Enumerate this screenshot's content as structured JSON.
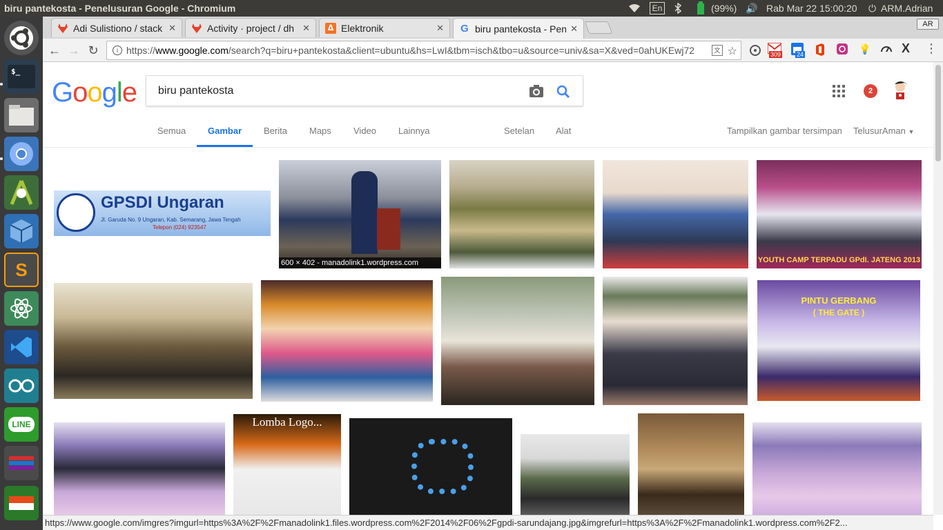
{
  "window_title": "biru pantekosta - Penelusuran Google - Chromium",
  "indicators": {
    "lang": "En",
    "battery": "(99%)",
    "volume": "🔊",
    "datetime": "Rab Mar 22 15:00:20",
    "user": "ARM.Adrian"
  },
  "tabs": [
    {
      "title": "Adi Sulistiono / stack",
      "favicon": "gitlab-icon",
      "color": "#e24329"
    },
    {
      "title": "Activity · project / dh",
      "favicon": "gitlab-icon",
      "color": "#e24329"
    },
    {
      "title": "Elektronik",
      "favicon": "shop-icon",
      "color": "#f57224"
    },
    {
      "title": "biru pantekosta - Pen",
      "favicon": "google-icon",
      "color": "#4285f4"
    }
  ],
  "profile_badge": "AR",
  "url": {
    "scheme": "https://",
    "domain": "www.google.com",
    "path": "/search?q=biru+pantekosta&client=ubuntu&hs=LwI&tbm=isch&tbo=u&source=univ&sa=X&ved=0ahUKEwj72"
  },
  "extensions": [
    {
      "name": "gmail-icon",
      "badge": "309",
      "color": "#d93025"
    },
    {
      "name": "calendar-icon",
      "badge": "24",
      "color": "#1a73e8"
    },
    {
      "name": "office-icon",
      "badge": "",
      "color": "#eb3c00"
    },
    {
      "name": "instagram-icon",
      "badge": "",
      "color": "#c13584"
    }
  ],
  "search": {
    "query": "biru pantekosta",
    "notifications": "2"
  },
  "nav_tabs": [
    "Semua",
    "Gambar",
    "Berita",
    "Maps",
    "Video",
    "Lainnya"
  ],
  "nav_tools": [
    "Setelan",
    "Alat"
  ],
  "nav_right": [
    "Tampilkan gambar tersimpan",
    "TelusurAman"
  ],
  "thumb_captions": {
    "t0": "GPSDI Ungaran",
    "t0_sub": "Jl. Garuda No. 9 Ungaran, Kab. Semarang, Jawa Tengah",
    "t0_tel": "Telepon (024) 923547",
    "t1": "600 × 402 - manadolink1.wordpress.com",
    "t4": "YOUTH CAMP TERPADU GPdI. JATENG 2013",
    "t9": "PINTU GERBANG",
    "t9b": "( THE GATE )",
    "t11": "Lomba Logo..."
  },
  "status_url": "https://www.google.com/imgres?imgurl=https%3A%2F%2Fmanadolink1.files.wordpress.com%2F2014%2F06%2Fgpdi-sarundajang.jpg&imgrefurl=https%3A%2F%2Fmanadolink1.wordpress.com%2F2..."
}
